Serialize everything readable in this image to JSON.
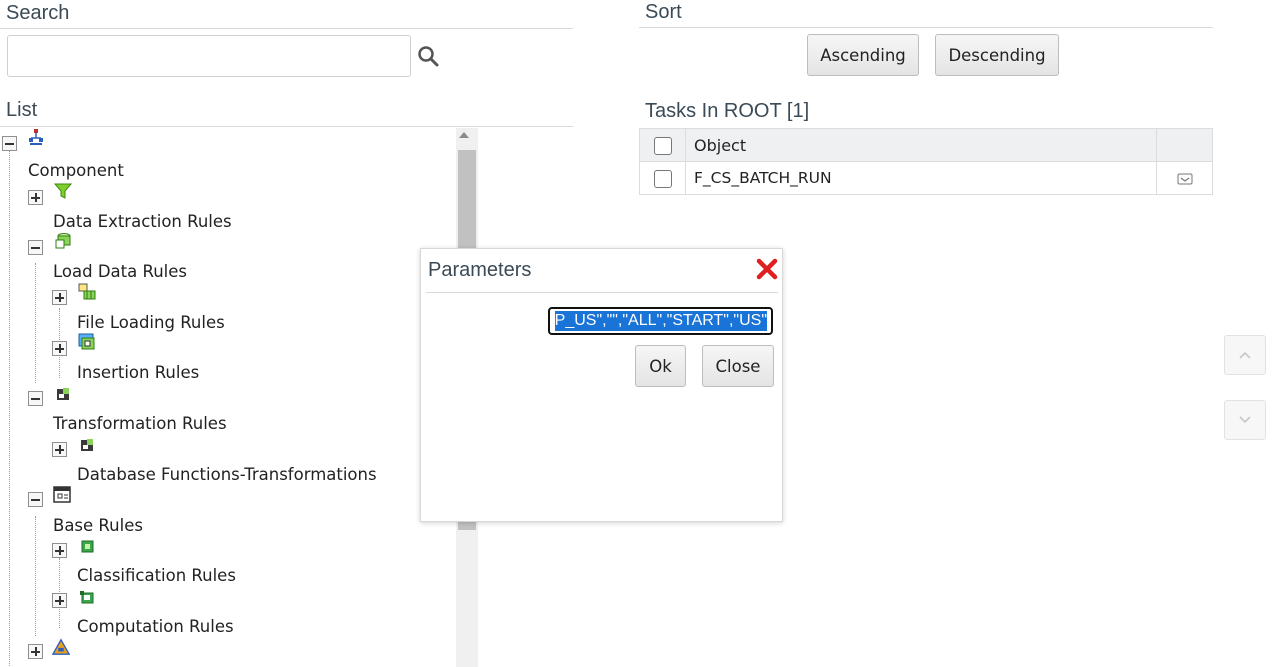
{
  "search": {
    "title": "Search",
    "value": "",
    "icon": "search-icon"
  },
  "list": {
    "title": "List"
  },
  "tree": {
    "root_icon": "hierarchy-icon",
    "nodes": [
      {
        "label": "Component",
        "icon": "hierarchy-icon"
      },
      {
        "label": "Data Extraction Rules",
        "icon": "filter-icon"
      },
      {
        "label": "Load Data Rules",
        "icon": "database-icon"
      },
      {
        "label": "File Loading Rules",
        "icon": "file-load-icon"
      },
      {
        "label": "Insertion Rules",
        "icon": "insert-icon"
      },
      {
        "label": "Transformation Rules",
        "icon": "transform-icon"
      },
      {
        "label": "Database Functions-Transformations",
        "icon": "transform-icon"
      },
      {
        "label": "Base Rules",
        "icon": "rules-icon"
      },
      {
        "label": "Classification Rules",
        "icon": "classification-icon"
      },
      {
        "label": "Computation Rules",
        "icon": "computation-icon"
      }
    ]
  },
  "sort": {
    "title": "Sort",
    "ascending_label": "Ascending",
    "descending_label": "Descending"
  },
  "tasks": {
    "title": "Tasks In ROOT [1]",
    "columns": [
      "Object"
    ],
    "rows": [
      {
        "object": "F_CS_BATCH_RUN"
      }
    ]
  },
  "dialog": {
    "title": "Parameters",
    "value": "P_US\",\"\",\"ALL\",\"START\",\"US\"",
    "ok_label": "Ok",
    "close_label": "Close"
  },
  "colors": {
    "accent": "#1a73d6",
    "close_red": "#e02020"
  }
}
